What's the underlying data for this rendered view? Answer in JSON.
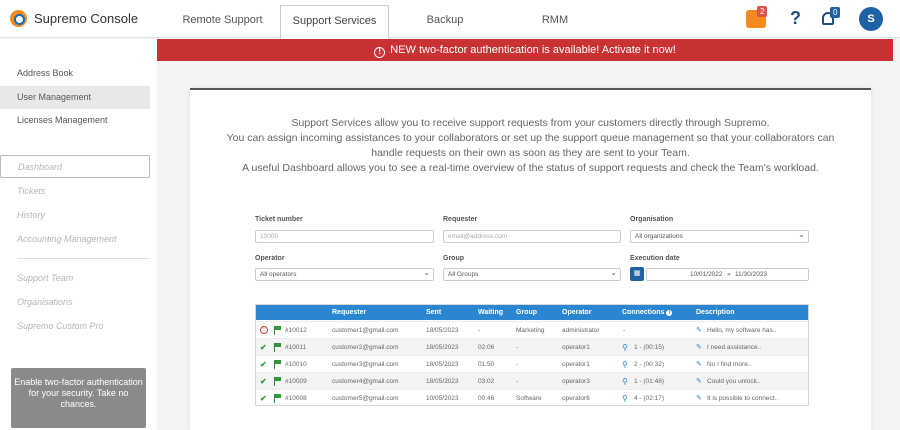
{
  "app": {
    "title": "Supremo Console"
  },
  "nav": {
    "tabs": [
      {
        "label": "Remote Support"
      },
      {
        "label": "Support Services"
      },
      {
        "label": "Backup"
      },
      {
        "label": "RMM"
      }
    ]
  },
  "header": {
    "puzzle_badge": "2",
    "help": "?",
    "bell_badge": "0",
    "avatar": "S"
  },
  "alert": {
    "text": "NEW two-factor authentication is available! Activate it now!"
  },
  "sidebar": {
    "items": [
      {
        "label": "Address Book"
      },
      {
        "label": "User Management"
      },
      {
        "label": "Licenses Management"
      },
      {
        "label": "Dashboard"
      },
      {
        "label": "Tickets"
      },
      {
        "label": "History"
      },
      {
        "label": "Accounting Management"
      },
      {
        "label": "Support Team"
      },
      {
        "label": "Organisations"
      },
      {
        "label": "Supremo Custom Pro"
      }
    ],
    "promo": "Enable two-factor authentication for your security. Take no chances."
  },
  "intro": {
    "line1": "Support Services allow you to receive support requests from your customers directly through Supremo.",
    "line2": "You can assign incoming assistances to your collaborators or set up the support queue management so that your collaborators can",
    "line3": "handle requests on their own as soon as they are sent to your Team.",
    "line4": "A useful Dashboard allows you to see a real-time overview of the status of support requests and check the Team's workload."
  },
  "filters": {
    "ticket_number": {
      "label": "Ticket number",
      "placeholder": "10000"
    },
    "requester": {
      "label": "Requester",
      "placeholder": "email@address.com"
    },
    "organisation": {
      "label": "Organisation",
      "value": "All organizations"
    },
    "operator": {
      "label": "Operator",
      "value": "All operators"
    },
    "group": {
      "label": "Group",
      "value": "All Groups"
    },
    "execution_date": {
      "label": "Execution date",
      "from": "10/01/2022",
      "separator": "»",
      "to": "11/30/2023"
    }
  },
  "table": {
    "columns": [
      "Requester",
      "Sent",
      "Waiting",
      "Group",
      "Operator",
      "Connections",
      "Description"
    ],
    "rows": [
      {
        "status": "error",
        "ticket": "#10012",
        "requester": "customer1@gmail.com",
        "sent": "18/05/2023",
        "waiting": "-",
        "group": "Marketing",
        "operator": "administrator",
        "connections": "-",
        "description": "Hello, my software has.."
      },
      {
        "status": "ok",
        "ticket": "#10011",
        "requester": "customer2@gmail.com",
        "sent": "18/05/2023",
        "waiting": "02:06",
        "group": "-",
        "operator": "operator1",
        "connections": "1 - (00:15)",
        "description": "I need assistance.."
      },
      {
        "status": "ok",
        "ticket": "#10010",
        "requester": "customer3@gmail.com",
        "sent": "18/05/2023",
        "waiting": "01:50",
        "group": "-",
        "operator": "operator1",
        "connections": "2 - (00:32)",
        "description": "No I find more.."
      },
      {
        "status": "ok",
        "ticket": "#10009",
        "requester": "customer4@gmail.com",
        "sent": "18/05/2023",
        "waiting": "03:02",
        "group": "-",
        "operator": "operator3",
        "connections": "1 - (01:48)",
        "description": "Could you unlock.."
      },
      {
        "status": "ok",
        "ticket": "#10008",
        "requester": "customer5@gmail.com",
        "sent": "10/05/2023",
        "waiting": "00:46",
        "group": "Software",
        "operator": "operator6",
        "connections": "4 - (02:17)",
        "description": "It is possible to connect.."
      }
    ]
  },
  "colors": {
    "brand_orange": "#f58a1f",
    "primary_blue": "#2a86d1",
    "alert_red": "#c83232",
    "ok_green": "#2e9a3a"
  }
}
